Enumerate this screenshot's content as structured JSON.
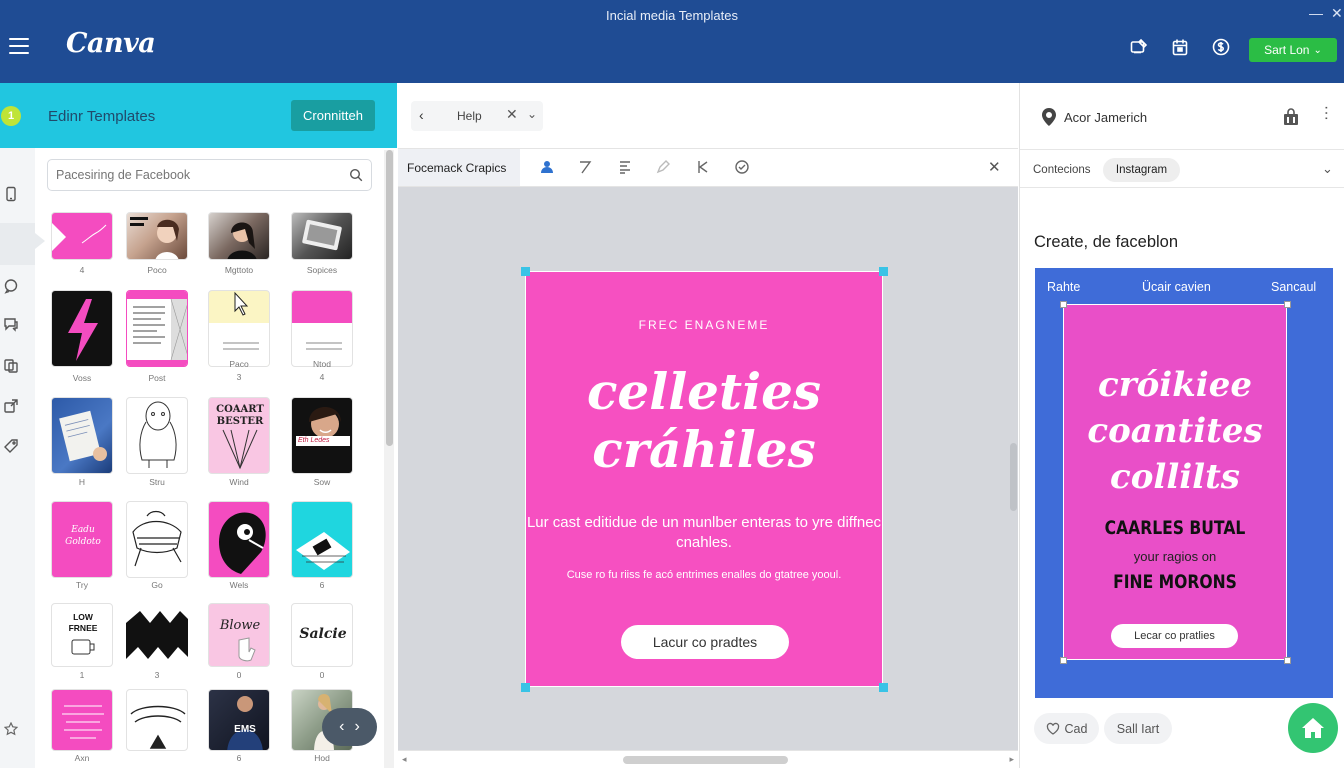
{
  "window": {
    "title": "Incial media Templates",
    "minimize": "—",
    "close": "✕"
  },
  "header": {
    "logo": "Canva",
    "icons": [
      "monitor-edit-icon",
      "calendar-icon",
      "currency-icon"
    ],
    "start_button": "Sart Lon",
    "start_chevron": "⌄",
    "accent": "#1f4c94",
    "button_color": "#2bbd45"
  },
  "left_panel": {
    "badge": "1",
    "title": "Edinr Templates",
    "action_button": "Cronnitteh",
    "accent": "#21c6e0",
    "search": {
      "placeholder": "Pacesiring de Facebook",
      "value": ""
    },
    "captions": [
      "4",
      "Poco",
      "Mgttoto",
      "Sopices",
      "Voss",
      "Post",
      "Paco",
      "3",
      "Ntod",
      "4",
      "H",
      "Stru",
      "Wind",
      "Sow",
      "Try",
      "Go",
      "Wels",
      "6",
      "1",
      "3",
      "0",
      "0",
      "Axn",
      "",
      "6",
      "Hod"
    ],
    "tile_text": {
      "t9": "COAART BESTER",
      "t12": "Eth Ledes",
      "t13": "Eadu Goldoto",
      "t17": "LOW FRNEE",
      "t19": "Blowe",
      "t20": "Salcie",
      "t23": "EMS"
    },
    "nav_prev": "‹",
    "nav_next": "›"
  },
  "editor": {
    "nav": {
      "back": "‹",
      "label": "Help",
      "close": "✕",
      "chevron": "⌄"
    },
    "toolbar_title": "Focemack Crapics",
    "toolbar_close": "✕",
    "design": {
      "kicker": "FREC ENAGNEME",
      "script_line1": "celleties",
      "script_line2": "cráhiles",
      "body": "Lur cast editidue de un munlber enteras to yre diffnec cnahles.",
      "small": "Cuse ro fu riiss fe acó entrimes enalles do gtatree yooul.",
      "cta": "Lacur co pradtes",
      "background": "#f650c1"
    },
    "hscroll_left": "◂",
    "hscroll_right": "▸"
  },
  "right_panel": {
    "location": "Acor Jamerich",
    "more": "···",
    "connections_label": "Contecions",
    "connections_chip": "Instagram",
    "chevron": "⌄",
    "heading": "Create, de faceblon",
    "preview": {
      "tab_left": "Rahte",
      "tab_center": "Ücair cavien",
      "tab_right": "Sancaul",
      "script_line1": "cróikiee",
      "script_line2": "coantites",
      "script_line3": "collilts",
      "caps_line1": "CAARLES BUTAL",
      "small": "your ragios on",
      "caps_line2": "FINE MORONS",
      "cta": "Lecar co pratlies",
      "background": "#3f6cd8"
    },
    "buttons": [
      "Cad",
      "Sall Iart"
    ]
  }
}
